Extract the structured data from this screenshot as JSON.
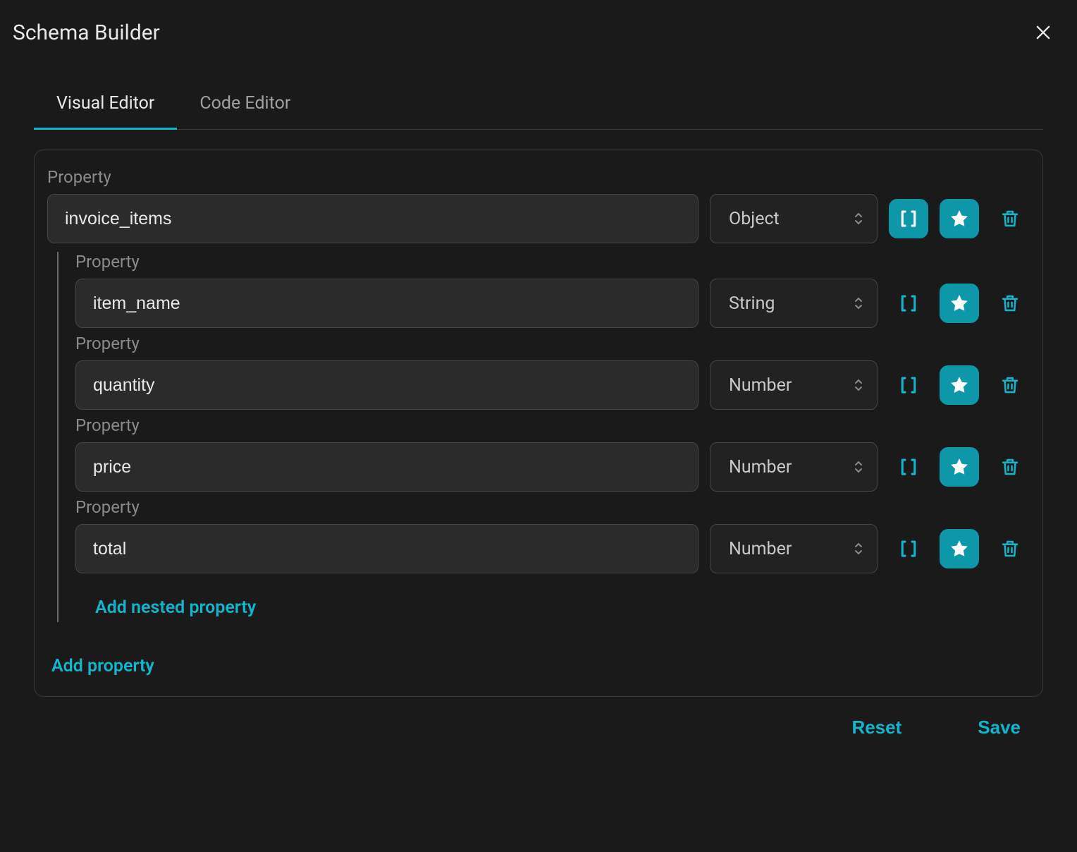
{
  "modal": {
    "title": "Schema Builder"
  },
  "tabs": {
    "visual": "Visual Editor",
    "code": "Code Editor"
  },
  "labels": {
    "property": "Property",
    "add_nested": "Add nested property",
    "add_property": "Add property"
  },
  "properties": {
    "root": {
      "name": "invoice_items",
      "type": "Object",
      "array_active": true,
      "star_active": true
    },
    "children": [
      {
        "name": "item_name",
        "type": "String",
        "array_active": false,
        "star_active": true
      },
      {
        "name": "quantity",
        "type": "Number",
        "array_active": false,
        "star_active": true
      },
      {
        "name": "price",
        "type": "Number",
        "array_active": false,
        "star_active": true
      },
      {
        "name": "total",
        "type": "Number",
        "array_active": false,
        "star_active": true
      }
    ]
  },
  "footer": {
    "reset": "Reset",
    "save": "Save"
  }
}
